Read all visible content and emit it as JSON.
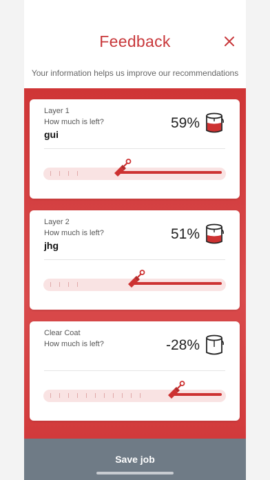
{
  "header": {
    "title": "Feedback",
    "subtitle": "Your information helps us improve our recommendations"
  },
  "cards": [
    {
      "layer": "Layer 1",
      "question": "How much is left?",
      "job": "gui",
      "percent_text": "59%",
      "remaining": 0.59,
      "tick_count": 4
    },
    {
      "layer": "Layer 2",
      "question": "How much is left?",
      "job": "jhg",
      "percent_text": "51%",
      "remaining": 0.51,
      "tick_count": 4
    },
    {
      "layer": "Clear Coat",
      "question": "How much is left?",
      "job": "",
      "percent_text": "-28%",
      "remaining": 0.28,
      "tick_count": 11
    }
  ],
  "footer": {
    "save_label": "Save job"
  },
  "colors": {
    "accent": "#cd3232",
    "footer": "#6f7b86",
    "track": "#f9e3e3"
  },
  "icons": {
    "close": "close-icon",
    "bucket": "paint-bucket-icon",
    "thumb": "paint-brush-icon"
  }
}
